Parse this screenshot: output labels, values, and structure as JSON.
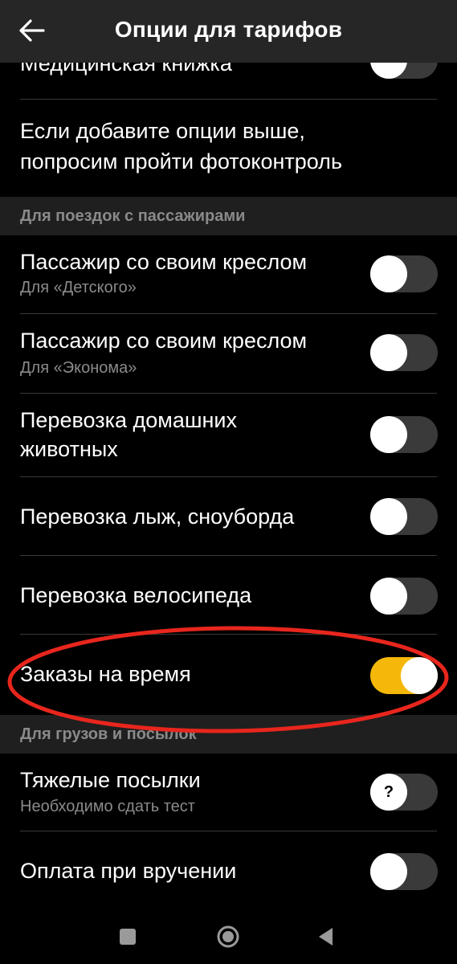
{
  "header": {
    "title": "Опции для тарифов",
    "back_icon": "arrow-left-icon"
  },
  "top_partial": {
    "label": "Медицинская книжка",
    "toggle_on": false
  },
  "info_text": {
    "line1": "Если добавите опции выше,",
    "line2": "попросим пройти фотоконтроль"
  },
  "sections": {
    "passengers": {
      "title": "Для поездок с пассажирами",
      "items": [
        {
          "label": "Пассажир со своим креслом",
          "sublabel": "Для «Детского»",
          "toggle_on": false
        },
        {
          "label": "Пассажир со своим креслом",
          "sublabel": "Для «Эконома»",
          "toggle_on": false
        },
        {
          "label_line1": "Перевозка домашних",
          "label_line2": "животных",
          "toggle_on": false
        },
        {
          "label": "Перевозка лыж, сноуборда",
          "toggle_on": false
        },
        {
          "label": "Перевозка велосипеда",
          "toggle_on": false
        },
        {
          "label": "Заказы на время",
          "toggle_on": true
        }
      ]
    },
    "cargo": {
      "title": "Для грузов и посылок",
      "items": [
        {
          "label": "Тяжелые посылки",
          "sublabel": "Необходимо сдать тест",
          "toggle_on": false,
          "knob_text": "?"
        },
        {
          "label": "Оплата при вручении",
          "toggle_on": false
        }
      ]
    }
  },
  "colors": {
    "background": "#000000",
    "header": "#262626",
    "section_bg": "#1f1f1f",
    "toggle_on": "#f5b80a",
    "toggle_off": "#3a3a3a",
    "annotation": "#e8261d"
  },
  "navbar": {
    "recents_icon": "square-icon",
    "home_icon": "circle-home-icon",
    "back_icon": "triangle-back-icon"
  }
}
